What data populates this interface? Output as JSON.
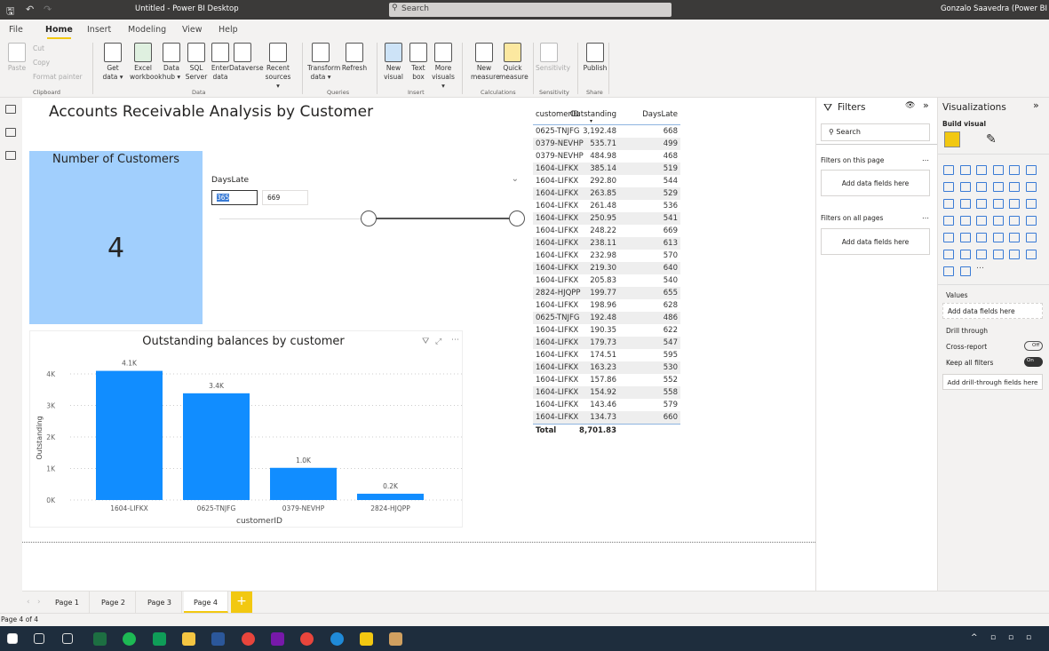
{
  "titlebar": {
    "title": "Untitled - Power BI Desktop",
    "search_placeholder": "Search",
    "user": "Gonzalo Saavedra (Power BI"
  },
  "menu": [
    "File",
    "Home",
    "Insert",
    "Modeling",
    "View",
    "Help"
  ],
  "ribbon": {
    "buttons": [
      {
        "label": "Paste",
        "disabled": true
      },
      {
        "label": "Cut",
        "disabled": true
      },
      {
        "label": "Copy",
        "disabled": true
      },
      {
        "label": "Format painter",
        "disabled": true
      },
      {
        "label": "Get data ▾"
      },
      {
        "label": "Excel workbook"
      },
      {
        "label": "Data hub ▾"
      },
      {
        "label": "SQL Server"
      },
      {
        "label": "Enter data"
      },
      {
        "label": "Dataverse"
      },
      {
        "label": "Recent sources ▾"
      },
      {
        "label": "Transform data ▾"
      },
      {
        "label": "Refresh"
      },
      {
        "label": "New visual"
      },
      {
        "label": "Text box"
      },
      {
        "label": "More visuals ▾"
      },
      {
        "label": "New measure"
      },
      {
        "label": "Quick measure"
      },
      {
        "label": "Sensitivity",
        "disabled": true
      },
      {
        "label": "Publish"
      }
    ],
    "groups": [
      "Clipboard",
      "Data",
      "Queries",
      "Insert",
      "Calculations",
      "Sensitivity",
      "Share"
    ]
  },
  "report": {
    "title": "Accounts Receivable Analysis by Customer",
    "card": {
      "label": "Number of Customers",
      "value": "4",
      "color": "#a1cffd"
    },
    "slicer": {
      "title": "DaysLate",
      "min": "365",
      "max": "669",
      "range_fraction": [
        0.5,
        1.0
      ]
    },
    "table": {
      "columns": [
        "customerID",
        "Outstanding",
        "DaysLate"
      ],
      "sort": "Outstanding descending",
      "rows": [
        [
          "0625-TNJFG",
          "3,192.48",
          "668"
        ],
        [
          "0379-NEVHP",
          "535.71",
          "499"
        ],
        [
          "0379-NEVHP",
          "484.98",
          "468"
        ],
        [
          "1604-LIFKX",
          "385.14",
          "519"
        ],
        [
          "1604-LIFKX",
          "292.80",
          "544"
        ],
        [
          "1604-LIFKX",
          "263.85",
          "529"
        ],
        [
          "1604-LIFKX",
          "261.48",
          "536"
        ],
        [
          "1604-LIFKX",
          "250.95",
          "541"
        ],
        [
          "1604-LIFKX",
          "248.22",
          "669"
        ],
        [
          "1604-LIFKX",
          "238.11",
          "613"
        ],
        [
          "1604-LIFKX",
          "232.98",
          "570"
        ],
        [
          "1604-LIFKX",
          "219.30",
          "640"
        ],
        [
          "1604-LIFKX",
          "205.83",
          "540"
        ],
        [
          "2824-HJQPP",
          "199.77",
          "655"
        ],
        [
          "1604-LIFKX",
          "198.96",
          "628"
        ],
        [
          "0625-TNJFG",
          "192.48",
          "486"
        ],
        [
          "1604-LIFKX",
          "190.35",
          "622"
        ],
        [
          "1604-LIFKX",
          "179.73",
          "547"
        ],
        [
          "1604-LIFKX",
          "174.51",
          "595"
        ],
        [
          "1604-LIFKX",
          "163.23",
          "530"
        ],
        [
          "1604-LIFKX",
          "157.86",
          "552"
        ],
        [
          "1604-LIFKX",
          "154.92",
          "558"
        ],
        [
          "1604-LIFKX",
          "143.46",
          "579"
        ],
        [
          "1604-LIFKX",
          "134.73",
          "660"
        ]
      ],
      "total_label": "Total",
      "total_value": "8,701.83"
    }
  },
  "chart_data": {
    "type": "bar",
    "title": "Outstanding balances by customer",
    "xlabel": "customerID",
    "ylabel": "Outstanding",
    "categories": [
      "1604-LIFKX",
      "0625-TNJFG",
      "0379-NEVHP",
      "2824-HJQPP"
    ],
    "values": [
      4096.41,
      3384.96,
      1020.69,
      199.77
    ],
    "data_labels": [
      "4.1K",
      "3.4K",
      "1.0K",
      "0.2K"
    ],
    "yticks": [
      "0K",
      "1K",
      "2K",
      "3K",
      "4K"
    ],
    "ylim": [
      0,
      4400
    ],
    "grid": true,
    "color": "#118dff"
  },
  "filters": {
    "title": "Filters",
    "search_placeholder": "Search",
    "on_page": "Filters on this page",
    "on_all": "Filters on all pages",
    "add": "Add data fields here"
  },
  "viz": {
    "title": "Visualizations",
    "build": "Build visual",
    "values": "Values",
    "add": "Add data fields here",
    "drill": "Drill through",
    "cross": "Cross-report",
    "cross_state": "Off",
    "keep": "Keep all filters",
    "keep_state": "On",
    "add_drill": "Add drill-through fields here",
    "icons": [
      "stacked-bar-icon",
      "stacked-column-icon",
      "clustered-bar-icon",
      "clustered-column-icon",
      "100-bar-icon",
      "100-column-icon",
      "line-chart-icon",
      "area-chart-icon",
      "stacked-area-icon",
      "line-column-icon",
      "line-clustered-icon",
      "ribbon-chart-icon",
      "waterfall-icon",
      "funnel-icon",
      "scatter-icon",
      "pie-icon",
      "donut-icon",
      "treemap-icon",
      "map-icon",
      "filled-map-icon",
      "gauge-icon",
      "card-icon",
      "multirow-card-icon",
      "kpi-icon",
      "slicer-icon",
      "table-icon",
      "matrix-icon",
      "r-visual-icon",
      "python-visual-icon",
      "key-influencers-icon",
      "decomposition-tree-icon",
      "qa-icon",
      "paginated-report-icon",
      "smart-narrative-icon",
      "power-apps-icon",
      "power-automate-icon",
      "arcgis-icon",
      "metrics-icon",
      "more-visuals-icon"
    ]
  },
  "pages": [
    "Page 1",
    "Page 2",
    "Page 3",
    "Page 4"
  ],
  "active_page": "Page 4",
  "status": "Page 4 of 4",
  "taskbar": [
    "windows-start-icon",
    "search-icon",
    "task-view-icon",
    "excel-icon",
    "spotify-icon",
    "chat-icon",
    "file-explorer-icon",
    "word-icon",
    "chrome-icon",
    "onenote-icon",
    "chrome-icon",
    "edge-icon",
    "power-bi-icon",
    "paint-icon"
  ]
}
